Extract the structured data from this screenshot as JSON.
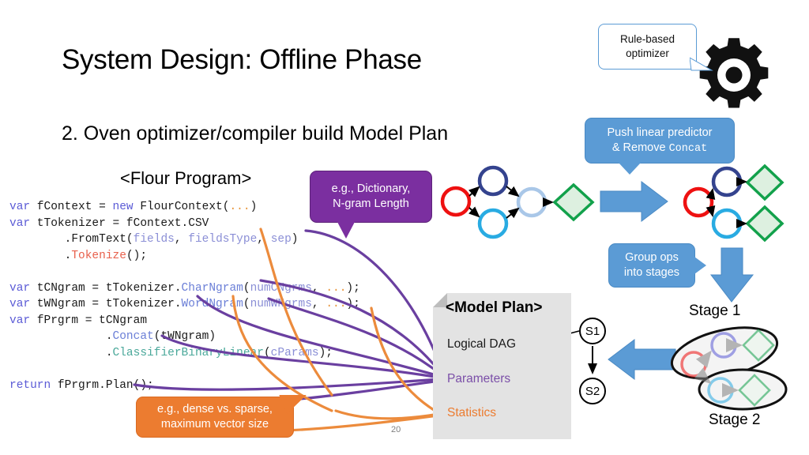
{
  "slide": {
    "title": "System Design: Offline Phase",
    "subtitle": "2. Oven optimizer/compiler build Model Plan",
    "flour_label": "<Flour Program>",
    "page_number": "20"
  },
  "code": {
    "lines": [
      "var fContext = new FlourContext(...)",
      "var tTokenizer = fContext.CSV",
      "        .FromText(fields, fieldsType, sep)",
      "        .Tokenize();",
      "",
      "var tCNgram = tTokenizer.CharNgram(numCNgrms, ...);",
      "var tWNgram = tTokenizer.WordNgram(numWNgrms, ...);",
      "var fPrgrm = tCNgram",
      "              .Concat(tWNgram)",
      "              .ClassifierBinaryLinear(cParams);",
      "",
      "return fPrgrm.Plan();"
    ],
    "colors": {
      "keyword": "#5b5bd6",
      "argument": "#8b8fd6",
      "ellipsis": "#e8953a",
      "method_red": "#e8604c",
      "method_blue": "#6b7fd7",
      "method_teal": "#4aa89a"
    }
  },
  "callouts": {
    "purple": {
      "line1": "e.g., Dictionary,",
      "line2": "N-gram Length",
      "color": "#7b2fa0"
    },
    "orange": {
      "line1": "e.g., dense vs. sparse,",
      "line2": "maximum vector size",
      "color": "#ec7c30"
    },
    "rule_based": {
      "line1": "Rule-based",
      "line2": "optimizer",
      "color": "#5b9bd5"
    },
    "push_predictor": {
      "line1": "Push linear predictor",
      "line2_prefix": "& Remove ",
      "line2_mono": "Concat",
      "color": "#5b9bd5"
    },
    "group_ops": {
      "line1": "Group ops",
      "line2": "into stages",
      "color": "#5b9bd5"
    }
  },
  "model_plan": {
    "title": "<Model Plan>",
    "rows": [
      {
        "label": "Logical DAG",
        "color": "#1a1a1a"
      },
      {
        "label": "Parameters",
        "color": "#7b4fa8"
      },
      {
        "label": "Statistics",
        "color": "#ec7c30"
      }
    ]
  },
  "stages": {
    "s1_label": "S1",
    "s2_label": "S2",
    "stage1_label": "Stage 1",
    "stage2_label": "Stage 2"
  },
  "dag_left": {
    "nodes": [
      {
        "name": "input",
        "shape": "circle",
        "color": "#ee1111"
      },
      {
        "name": "tokenizer-a",
        "shape": "circle",
        "color": "#34438e"
      },
      {
        "name": "tokenizer-b",
        "shape": "circle",
        "color": "#29abe2"
      },
      {
        "name": "concat",
        "shape": "circle",
        "color": "#a9c7e8"
      },
      {
        "name": "predictor",
        "shape": "diamond",
        "color": "#12a14b"
      }
    ]
  },
  "dag_right": {
    "nodes": [
      {
        "name": "input",
        "shape": "circle",
        "color": "#ee1111"
      },
      {
        "name": "charngram",
        "shape": "circle",
        "color": "#34438e"
      },
      {
        "name": "wordngram",
        "shape": "circle",
        "color": "#29abe2"
      },
      {
        "name": "predictor-1",
        "shape": "diamond",
        "color": "#12a14b"
      },
      {
        "name": "predictor-2",
        "shape": "diamond",
        "color": "#12a14b"
      }
    ]
  }
}
